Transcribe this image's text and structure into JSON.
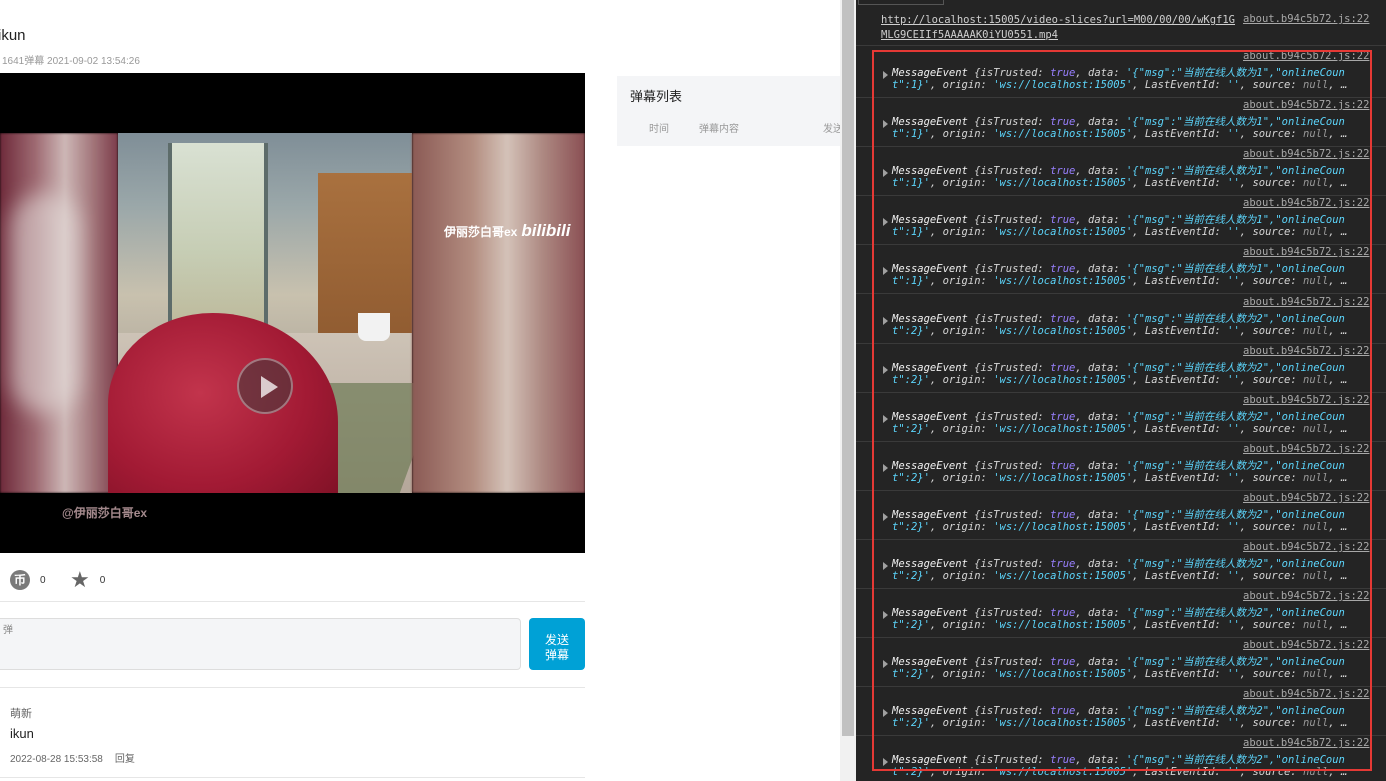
{
  "video": {
    "title": "ikun",
    "meta": "1641弹幕 2021-09-02 13:54:26",
    "watermark_right_text": "伊丽莎白哥ex",
    "watermark_right_logo": "bilibili",
    "watermark_left_text": "@伊丽莎白哥ex"
  },
  "actions": {
    "coin_glyph": "币",
    "coin_count": "0",
    "fav_count": "0"
  },
  "danmaku_input": {
    "placeholder": "弹",
    "send_label_1": "发送",
    "send_label_2": "弹幕"
  },
  "comment": {
    "user": "萌新",
    "text": "ikun",
    "time": "2022-08-28 15:53:58",
    "reply": "回复"
  },
  "danmaku_panel": {
    "title": "弹幕列表",
    "col_time": "时间",
    "col_content": "弹幕内容",
    "col_sent": "发送"
  },
  "console": {
    "first": {
      "url": "http://localhost:15005/video-slices?url=M00/00/00/wKgf1GMLG9CEIIf5AAAAAK0iYU0551.mp4",
      "src": "about.b94c5b72.js:22"
    },
    "entries": [
      {
        "src": "about.b94c5b72.js:22",
        "cls": "MessageEvent",
        "k_trusted": "isTrusted",
        "v_trusted": "true",
        "k_data": "data",
        "v_data": "'{\"msg\":\"当前在线人数为1\",\"onlineCoun",
        "l2_start": "t\":1}'",
        "k_origin": "origin",
        "v_origin": "'ws://localhost:15005'",
        "k_last": "LastEventId",
        "v_last": "''",
        "k_source": "source",
        "v_source": "null",
        "ellipsis": "…"
      },
      {
        "src": "about.b94c5b72.js:22",
        "cls": "MessageEvent",
        "k_trusted": "isTrusted",
        "v_trusted": "true",
        "k_data": "data",
        "v_data": "'{\"msg\":\"当前在线人数为1\",\"onlineCoun",
        "l2_start": "t\":1}'",
        "k_origin": "origin",
        "v_origin": "'ws://localhost:15005'",
        "k_last": "LastEventId",
        "v_last": "''",
        "k_source": "source",
        "v_source": "null",
        "ellipsis": "…"
      },
      {
        "src": "about.b94c5b72.js:22",
        "cls": "MessageEvent",
        "k_trusted": "isTrusted",
        "v_trusted": "true",
        "k_data": "data",
        "v_data": "'{\"msg\":\"当前在线人数为1\",\"onlineCoun",
        "l2_start": "t\":1}'",
        "k_origin": "origin",
        "v_origin": "'ws://localhost:15005'",
        "k_last": "LastEventId",
        "v_last": "''",
        "k_source": "source",
        "v_source": "null",
        "ellipsis": "…"
      },
      {
        "src": "about.b94c5b72.js:22",
        "cls": "MessageEvent",
        "k_trusted": "isTrusted",
        "v_trusted": "true",
        "k_data": "data",
        "v_data": "'{\"msg\":\"当前在线人数为1\",\"onlineCoun",
        "l2_start": "t\":1}'",
        "k_origin": "origin",
        "v_origin": "'ws://localhost:15005'",
        "k_last": "LastEventId",
        "v_last": "''",
        "k_source": "source",
        "v_source": "null",
        "ellipsis": "…"
      },
      {
        "src": "about.b94c5b72.js:22",
        "cls": "MessageEvent",
        "k_trusted": "isTrusted",
        "v_trusted": "true",
        "k_data": "data",
        "v_data": "'{\"msg\":\"当前在线人数为1\",\"onlineCoun",
        "l2_start": "t\":1}'",
        "k_origin": "origin",
        "v_origin": "'ws://localhost:15005'",
        "k_last": "LastEventId",
        "v_last": "''",
        "k_source": "source",
        "v_source": "null",
        "ellipsis": "…"
      },
      {
        "src": "about.b94c5b72.js:22",
        "cls": "MessageEvent",
        "k_trusted": "isTrusted",
        "v_trusted": "true",
        "k_data": "data",
        "v_data": "'{\"msg\":\"当前在线人数为2\",\"onlineCoun",
        "l2_start": "t\":2}'",
        "k_origin": "origin",
        "v_origin": "'ws://localhost:15005'",
        "k_last": "LastEventId",
        "v_last": "''",
        "k_source": "source",
        "v_source": "null",
        "ellipsis": "…"
      },
      {
        "src": "about.b94c5b72.js:22",
        "cls": "MessageEvent",
        "k_trusted": "isTrusted",
        "v_trusted": "true",
        "k_data": "data",
        "v_data": "'{\"msg\":\"当前在线人数为2\",\"onlineCoun",
        "l2_start": "t\":2}'",
        "k_origin": "origin",
        "v_origin": "'ws://localhost:15005'",
        "k_last": "LastEventId",
        "v_last": "''",
        "k_source": "source",
        "v_source": "null",
        "ellipsis": "…"
      },
      {
        "src": "about.b94c5b72.js:22",
        "cls": "MessageEvent",
        "k_trusted": "isTrusted",
        "v_trusted": "true",
        "k_data": "data",
        "v_data": "'{\"msg\":\"当前在线人数为2\",\"onlineCoun",
        "l2_start": "t\":2}'",
        "k_origin": "origin",
        "v_origin": "'ws://localhost:15005'",
        "k_last": "LastEventId",
        "v_last": "''",
        "k_source": "source",
        "v_source": "null",
        "ellipsis": "…"
      },
      {
        "src": "about.b94c5b72.js:22",
        "cls": "MessageEvent",
        "k_trusted": "isTrusted",
        "v_trusted": "true",
        "k_data": "data",
        "v_data": "'{\"msg\":\"当前在线人数为2\",\"onlineCoun",
        "l2_start": "t\":2}'",
        "k_origin": "origin",
        "v_origin": "'ws://localhost:15005'",
        "k_last": "LastEventId",
        "v_last": "''",
        "k_source": "source",
        "v_source": "null",
        "ellipsis": "…"
      },
      {
        "src": "about.b94c5b72.js:22",
        "cls": "MessageEvent",
        "k_trusted": "isTrusted",
        "v_trusted": "true",
        "k_data": "data",
        "v_data": "'{\"msg\":\"当前在线人数为2\",\"onlineCoun",
        "l2_start": "t\":2}'",
        "k_origin": "origin",
        "v_origin": "'ws://localhost:15005'",
        "k_last": "LastEventId",
        "v_last": "''",
        "k_source": "source",
        "v_source": "null",
        "ellipsis": "…"
      },
      {
        "src": "about.b94c5b72.js:22",
        "cls": "MessageEvent",
        "k_trusted": "isTrusted",
        "v_trusted": "true",
        "k_data": "data",
        "v_data": "'{\"msg\":\"当前在线人数为2\",\"onlineCoun",
        "l2_start": "t\":2}'",
        "k_origin": "origin",
        "v_origin": "'ws://localhost:15005'",
        "k_last": "LastEventId",
        "v_last": "''",
        "k_source": "source",
        "v_source": "null",
        "ellipsis": "…"
      },
      {
        "src": "about.b94c5b72.js:22",
        "cls": "MessageEvent",
        "k_trusted": "isTrusted",
        "v_trusted": "true",
        "k_data": "data",
        "v_data": "'{\"msg\":\"当前在线人数为2\",\"onlineCoun",
        "l2_start": "t\":2}'",
        "k_origin": "origin",
        "v_origin": "'ws://localhost:15005'",
        "k_last": "LastEventId",
        "v_last": "''",
        "k_source": "source",
        "v_source": "null",
        "ellipsis": "…"
      },
      {
        "src": "about.b94c5b72.js:22",
        "cls": "MessageEvent",
        "k_trusted": "isTrusted",
        "v_trusted": "true",
        "k_data": "data",
        "v_data": "'{\"msg\":\"当前在线人数为2\",\"onlineCoun",
        "l2_start": "t\":2}'",
        "k_origin": "origin",
        "v_origin": "'ws://localhost:15005'",
        "k_last": "LastEventId",
        "v_last": "''",
        "k_source": "source",
        "v_source": "null",
        "ellipsis": "…"
      },
      {
        "src": "about.b94c5b72.js:22",
        "cls": "MessageEvent",
        "k_trusted": "isTrusted",
        "v_trusted": "true",
        "k_data": "data",
        "v_data": "'{\"msg\":\"当前在线人数为2\",\"onlineCoun",
        "l2_start": "t\":2}'",
        "k_origin": "origin",
        "v_origin": "'ws://localhost:15005'",
        "k_last": "LastEventId",
        "v_last": "''",
        "k_source": "source",
        "v_source": "null",
        "ellipsis": "…"
      },
      {
        "src": "about.b94c5b72.js:22",
        "cls": "MessageEvent",
        "k_trusted": "isTrusted",
        "v_trusted": "true",
        "k_data": "data",
        "v_data": "'{\"msg\":\"当前在线人数为2\",\"onlineCoun",
        "l2_start": "t\":2}'",
        "k_origin": "origin",
        "v_origin": "'ws://localhost:15005'",
        "k_last": "LastEventId",
        "v_last": "''",
        "k_source": "source",
        "v_source": "null",
        "ellipsis": "…"
      }
    ]
  },
  "colors": {
    "devtools_bg": "#242424",
    "highlight_box": "#e53935",
    "send_button": "#00a1d6",
    "string_value": "#5cd5fb",
    "boolean_value": "#9980ff"
  }
}
